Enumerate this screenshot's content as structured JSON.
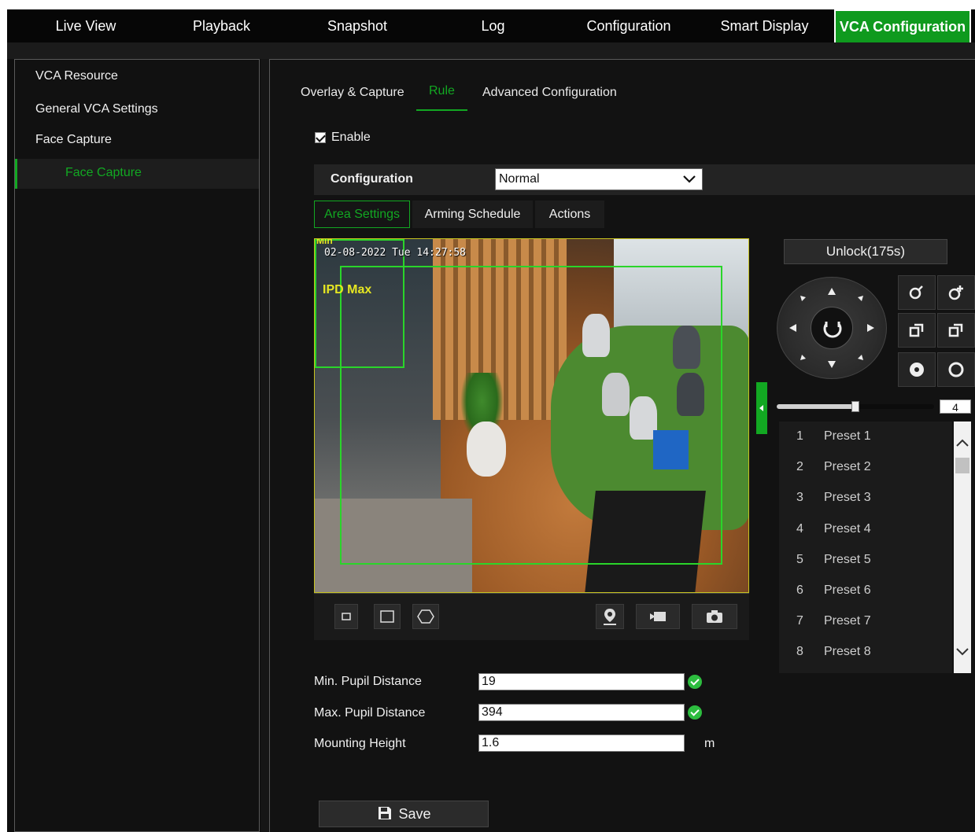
{
  "nav": {
    "items": [
      {
        "label": "Live View"
      },
      {
        "label": "Playback"
      },
      {
        "label": "Snapshot"
      },
      {
        "label": "Log"
      },
      {
        "label": "Configuration"
      },
      {
        "label": "Smart Display"
      },
      {
        "label": "VCA Configuration",
        "active": true
      }
    ]
  },
  "sidebar": {
    "items": [
      {
        "label": "VCA Resource"
      },
      {
        "label": "General VCA Settings"
      },
      {
        "label": "Face Capture"
      }
    ],
    "sub_item": {
      "label": "Face Capture",
      "active": true
    }
  },
  "tabs": [
    {
      "label": "Overlay & Capture"
    },
    {
      "label": "Rule",
      "active": true
    },
    {
      "label": "Advanced Configuration"
    }
  ],
  "enable": {
    "label": "Enable",
    "checked": true
  },
  "configuration": {
    "label": "Configuration",
    "value": "Normal"
  },
  "subtabs": [
    {
      "label": "Area Settings",
      "active": true
    },
    {
      "label": "Arming Schedule"
    },
    {
      "label": "Actions"
    }
  ],
  "video": {
    "osd_text": "02-08-2022 Tue 14:27:58",
    "ipd_min_label": "Min",
    "ipd_max_label": "IPD Max"
  },
  "ptz": {
    "unlock_label": "Unlock(175s)",
    "speed": "4",
    "speed_fraction": 0.5
  },
  "presets": [
    {
      "num": "1",
      "name": "Preset 1"
    },
    {
      "num": "2",
      "name": "Preset 2"
    },
    {
      "num": "3",
      "name": "Preset 3"
    },
    {
      "num": "4",
      "name": "Preset 4"
    },
    {
      "num": "5",
      "name": "Preset 5"
    },
    {
      "num": "6",
      "name": "Preset 6"
    },
    {
      "num": "7",
      "name": "Preset 7"
    },
    {
      "num": "8",
      "name": "Preset 8"
    }
  ],
  "form": {
    "min_pupil": {
      "label": "Min. Pupil Distance",
      "value": "19"
    },
    "max_pupil": {
      "label": "Max. Pupil Distance",
      "value": "394"
    },
    "mounting_height": {
      "label": "Mounting Height",
      "value": "1.6",
      "unit": "m"
    }
  },
  "save_label": "Save",
  "colors": {
    "accent": "#12a822",
    "nav_bg": "#060606",
    "panel_bg": "#121212"
  }
}
